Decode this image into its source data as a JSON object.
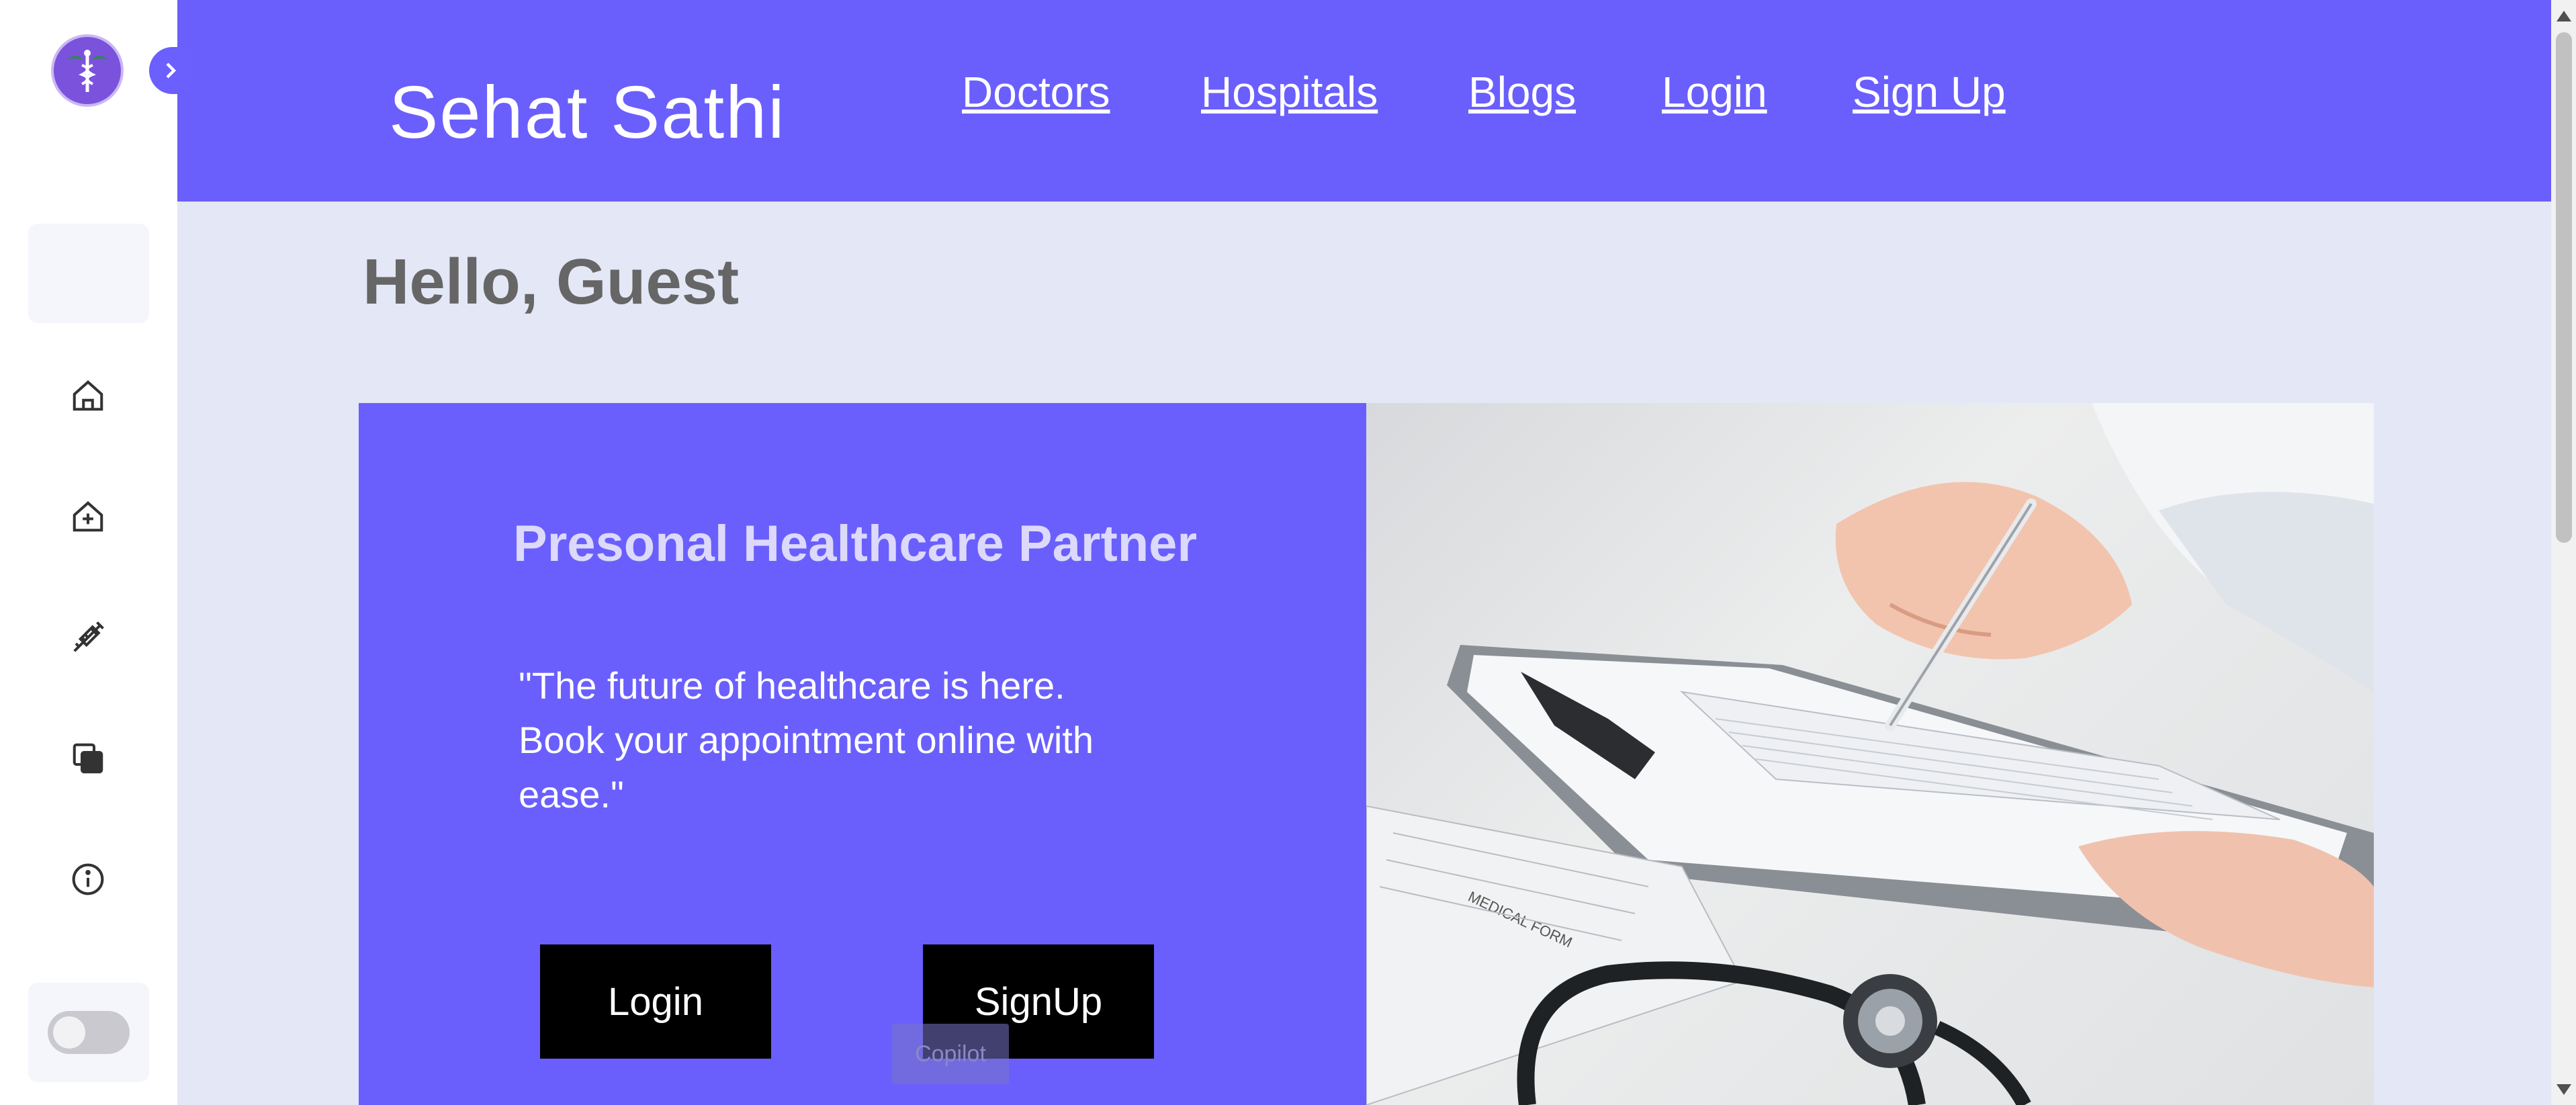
{
  "header": {
    "brand": "Sehat Sathi",
    "nav": [
      "Doctors",
      "Hospitals",
      "Blogs",
      "Login",
      "Sign Up"
    ]
  },
  "main": {
    "greeting": "Hello, Guest",
    "hero_title": "Presonal Healthcare Partner",
    "hero_quote": "\"The future of healthcare is here. Book your appointment online with ease.\"",
    "login_button": "Login",
    "signup_button": "SignUp"
  },
  "overlay": {
    "copilot_label": "Copilot"
  },
  "sidebar": {
    "icons": [
      "home-icon",
      "hospital-icon",
      "syringe-icon",
      "copy-icon",
      "info-icon"
    ],
    "theme_toggle_on": false
  },
  "photo": {
    "form_label": "MEDICAL FORM"
  },
  "colors": {
    "accent": "#6a5ffd",
    "background": "#e3e7f6",
    "logo": "#7b52dc"
  }
}
